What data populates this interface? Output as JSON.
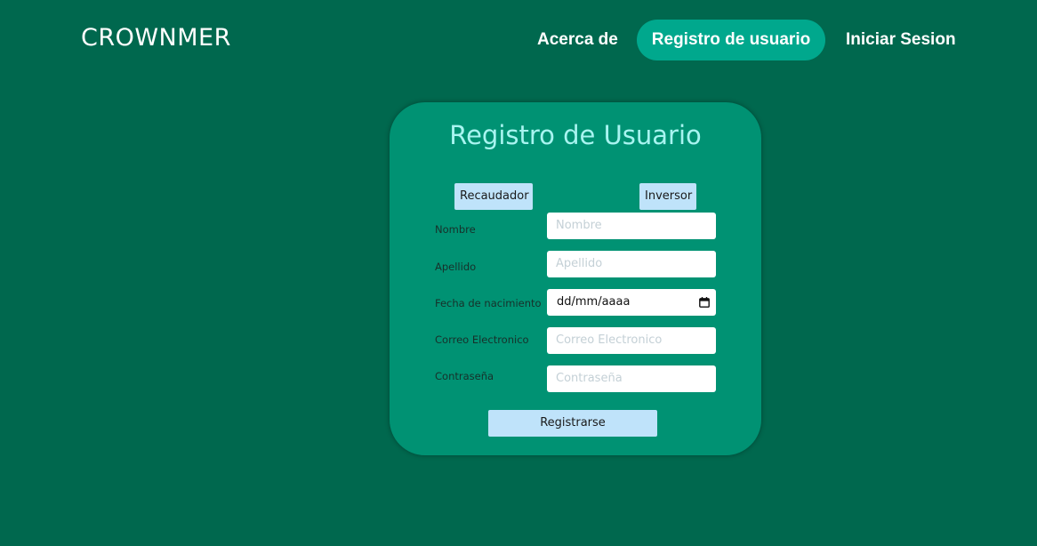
{
  "brand": "CROWNMER",
  "nav": {
    "about": "Acerca de",
    "register": "Registro de usuario",
    "login": "Iniciar Sesion"
  },
  "form": {
    "title": "Registro de Usuario",
    "roles": [
      "Recaudador",
      "Inversor"
    ],
    "fields": [
      {
        "label": "Nombre",
        "placeholder": "Nombre"
      },
      {
        "label": "Apellido",
        "placeholder": "Apellido"
      },
      {
        "label": "Fecha de nacimiento",
        "value": "dd/mm/aaaa"
      },
      {
        "label": "Correo Electronico",
        "placeholder": "Correo Electronico"
      },
      {
        "label": "Contraseña",
        "placeholder": "Contraseña"
      }
    ],
    "submit": "Registrarse"
  },
  "colors": {
    "background": "#00684e",
    "card": "#009273",
    "nav_active": "#00a88d",
    "title": "#a8f4f0",
    "button": "#bfe3fa"
  },
  "icons": {
    "date_picker": "calendar-icon"
  }
}
